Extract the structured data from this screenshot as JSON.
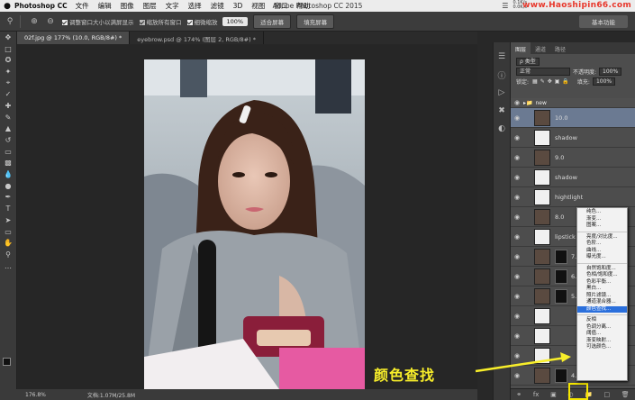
{
  "menubar": {
    "apple": "",
    "app_name": "Photoshop CC",
    "items": [
      "文件",
      "编辑",
      "图像",
      "图层",
      "文字",
      "选择",
      "滤镜",
      "3D",
      "视图",
      "窗口",
      "帮助"
    ],
    "window_title": "Adobe Photoshop CC 2015",
    "net_up": "0.1K/s",
    "net_down": "0.0K/s",
    "watermark": "www.Haoshipin66.com"
  },
  "options": {
    "check1": "调整窗口大小以满屏显示",
    "check2": "缩放所有窗口",
    "check3": "细微缩放",
    "zoom_value": "100%",
    "fit_screen": "适合屏幕",
    "fill_screen": "填充屏幕",
    "workspace": "基本功能"
  },
  "tabs": [
    {
      "label": "02f.jpg @ 177% (10.0, RGB/8#) *",
      "active": true
    },
    {
      "label": "eyebrow.psd @ 174% (图层 2, RGB/8#) *",
      "active": false
    }
  ],
  "status": {
    "zoom": "176.8%",
    "doc": "文档:1.07M/25.8M"
  },
  "panel": {
    "tabs": [
      "图层",
      "通道",
      "路径"
    ],
    "kind_label": "ρ 类型",
    "blend_mode": "正常",
    "opacity_label": "不透明度:",
    "opacity_value": "100%",
    "lock_label": "锁定:",
    "fill_label": "填充:",
    "fill_value": "100%",
    "group_name": "new",
    "layers": [
      {
        "name": "10.0",
        "thumb": "photo",
        "selected": true
      },
      {
        "name": "shadow",
        "thumb": "white",
        "selected": false
      },
      {
        "name": "9.0",
        "thumb": "photo",
        "selected": false
      },
      {
        "name": "shadow",
        "thumb": "white",
        "selected": false
      },
      {
        "name": "hightlight",
        "thumb": "white",
        "selected": false
      },
      {
        "name": "8.0",
        "thumb": "photo",
        "selected": false
      },
      {
        "name": "lipstick",
        "thumb": "white",
        "selected": false
      },
      {
        "name": "7.0",
        "thumb": "photo",
        "selected": false
      },
      {
        "name": "6.0",
        "thumb": "photo",
        "selected": false
      },
      {
        "name": "5.0",
        "thumb": "photo",
        "selected": false
      },
      {
        "name": "",
        "thumb": "white",
        "selected": false
      },
      {
        "name": "",
        "thumb": "white",
        "selected": false
      },
      {
        "name": "",
        "thumb": "white",
        "selected": false
      },
      {
        "name": "4.0",
        "thumb": "photo",
        "selected": false
      }
    ]
  },
  "adjust_menu": {
    "items": [
      {
        "label": "纯色...",
        "highlight": false,
        "sep_after": false
      },
      {
        "label": "渐变...",
        "highlight": false,
        "sep_after": false
      },
      {
        "label": "图案...",
        "highlight": false,
        "sep_after": true
      },
      {
        "label": "亮度/对比度...",
        "highlight": false,
        "sep_after": false
      },
      {
        "label": "色阶...",
        "highlight": false,
        "sep_after": false
      },
      {
        "label": "曲线...",
        "highlight": false,
        "sep_after": false
      },
      {
        "label": "曝光度...",
        "highlight": false,
        "sep_after": true
      },
      {
        "label": "自然饱和度...",
        "highlight": false,
        "sep_after": false
      },
      {
        "label": "色相/饱和度...",
        "highlight": false,
        "sep_after": false
      },
      {
        "label": "色彩平衡...",
        "highlight": false,
        "sep_after": false
      },
      {
        "label": "黑白...",
        "highlight": false,
        "sep_after": false
      },
      {
        "label": "照片滤镜...",
        "highlight": false,
        "sep_after": false
      },
      {
        "label": "通道混合器...",
        "highlight": false,
        "sep_after": false
      },
      {
        "label": "颜色查找...",
        "highlight": true,
        "sep_after": true
      },
      {
        "label": "反相",
        "highlight": false,
        "sep_after": false
      },
      {
        "label": "色调分离...",
        "highlight": false,
        "sep_after": false
      },
      {
        "label": "阈值...",
        "highlight": false,
        "sep_after": false
      },
      {
        "label": "渐变映射...",
        "highlight": false,
        "sep_after": false
      },
      {
        "label": "可选颜色...",
        "highlight": false,
        "sep_after": false
      }
    ]
  },
  "callout": "颜色查找",
  "colors": {
    "accent": "#f5e600",
    "selection": "#6b7a92",
    "menu_highlight": "#2a6fdc"
  }
}
